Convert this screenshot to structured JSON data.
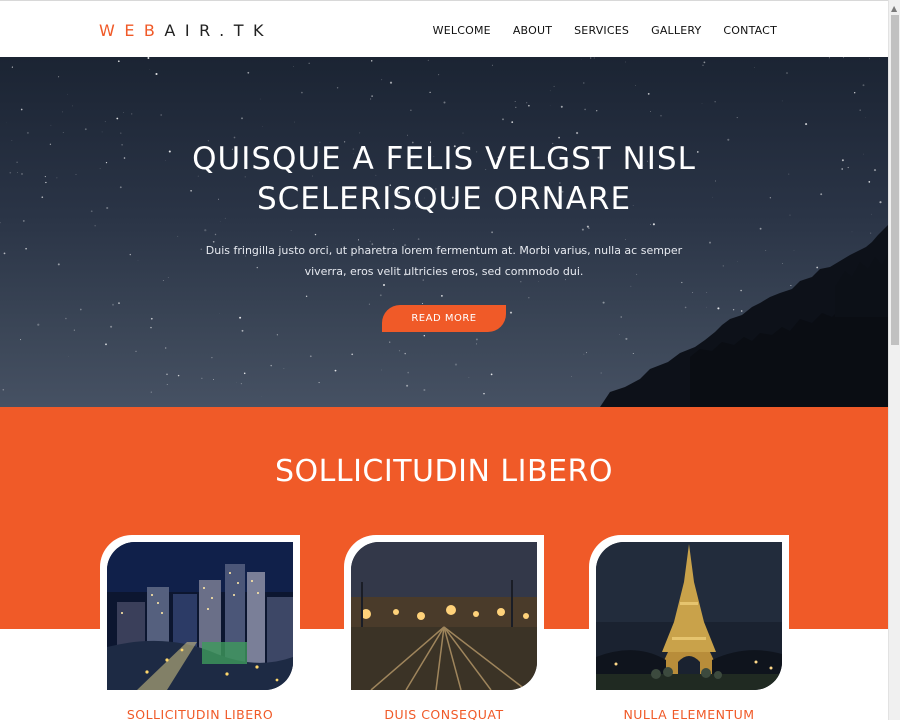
{
  "header": {
    "logo": {
      "part1": "WEB",
      "part2": "AIR",
      "part3": ".TK"
    },
    "nav": [
      "WELCOME",
      "ABOUT",
      "SERVICES",
      "GALLERY",
      "CONTACT"
    ]
  },
  "hero": {
    "title_line1": "QUISQUE A FELIS VELGST NISL",
    "title_line2": "SCELERISQUE ORNARE",
    "text_line1": "Duis fringilla justo orci, ut pharetra lorem fermentum at. Morbi varius, nulla ac semper",
    "text_line2": "viverra, eros velit ultricies eros, sed commodo dui.",
    "button": "READ MORE"
  },
  "services": {
    "title": "SOLLICITUDIN LIBERO",
    "cards": [
      {
        "label": "SOLLICITUDIN LIBERO"
      },
      {
        "label": "DUIS CONSEQUAT"
      },
      {
        "label": "NULLA ELEMENTUM"
      }
    ]
  },
  "colors": {
    "accent": "#f05a28",
    "hero_sky": "#2a3446",
    "text_dark": "#111111"
  },
  "icons": {
    "scroll_up": "scroll-up-arrow-icon"
  }
}
